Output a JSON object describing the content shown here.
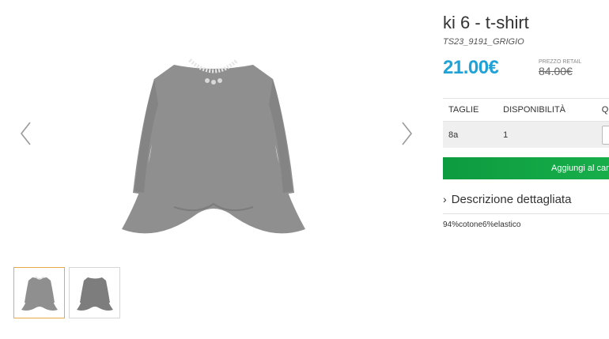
{
  "product": {
    "title": "ki 6 - t-shirt",
    "sku": "TS23_9191_GRIGIO",
    "price": "21.00€",
    "retail_label": "PREZZO RETAIL",
    "retail_price": "84.00€"
  },
  "sizes": {
    "headers": [
      "TAGLIE",
      "DISPONIBILITÀ",
      "Q"
    ],
    "rows": [
      {
        "size": "8a",
        "availability": "1"
      }
    ]
  },
  "actions": {
    "add_to_cart": "Aggiungi al carrello"
  },
  "description": {
    "toggle_label": "Descrizione dettagliata",
    "text": "94%cotone6%elastico"
  },
  "gallery": {
    "prev_icon": "chevron-left-icon",
    "next_icon": "chevron-right-icon",
    "thumb_count": 2,
    "active_thumb": 0
  },
  "colors": {
    "price": "#1ea2d8",
    "cart_button": "#13a646",
    "active_thumb_border": "#e8a94a",
    "garment": "#8f8f8f"
  }
}
